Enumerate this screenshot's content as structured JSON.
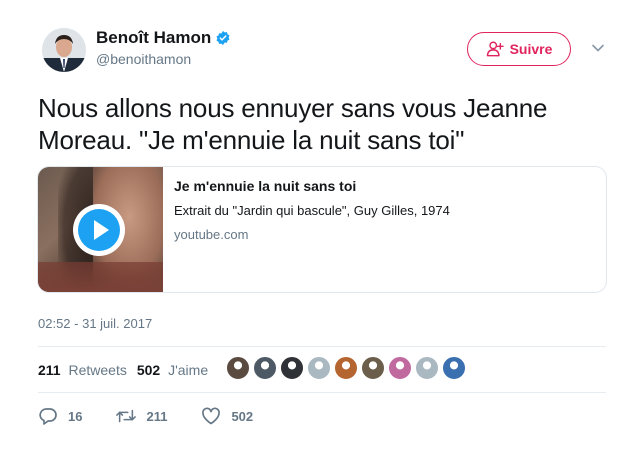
{
  "author": {
    "display_name": "Benoît Hamon",
    "handle": "@benoithamon",
    "verified": true
  },
  "follow_button": {
    "label": "Suivre"
  },
  "tweet": {
    "text": "Nous allons nous ennuyer sans vous Jeanne Moreau. \"Je m'ennuie la nuit sans toi\""
  },
  "card": {
    "title": "Je m'ennuie la nuit sans toi",
    "description": "Extrait du \"Jardin qui bascule\", Guy Gilles, 1974",
    "domain": "youtube.com"
  },
  "timestamp": "02:52 - 31 juil. 2017",
  "stats": {
    "retweets_count": "211",
    "retweets_label": "Retweets",
    "likes_count": "502",
    "likes_label": "J'aime"
  },
  "liker_avatars": [
    {
      "color": "#5b4a3f"
    },
    {
      "color": "#4d5a66"
    },
    {
      "color": "#2f3236"
    },
    {
      "color": "#aab8c2"
    },
    {
      "color": "#b5652f"
    },
    {
      "color": "#6b5e4a"
    },
    {
      "color": "#c06aa0"
    },
    {
      "color": "#aab8c2"
    },
    {
      "color": "#3a6fb0"
    }
  ],
  "actions": {
    "reply_count": "16",
    "retweet_count": "211",
    "like_count": "502"
  },
  "colors": {
    "accent": "#e0245e",
    "verified": "#1da1f2",
    "secondary_text": "#657786"
  },
  "icons": [
    "verified-badge-icon",
    "follow-person-icon",
    "chevron-down-icon",
    "play-icon",
    "reply-icon",
    "retweet-icon",
    "like-icon"
  ]
}
